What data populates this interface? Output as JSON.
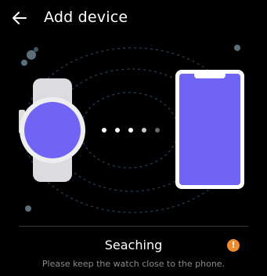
{
  "header": {
    "title": "Add device",
    "back_icon": "arrow-left-icon"
  },
  "scene": {
    "accent_color": "#7064f4",
    "dot_color": "#5a6f7a",
    "ring_color": "#22445a",
    "watch_color": "#e8e8ea",
    "phone_frame_color": "#ffffff",
    "pairing_dots": 5
  },
  "status": {
    "label": "Seaching",
    "info_icon": "info-icon",
    "info_color": "#f08a2e",
    "info_glyph": "!",
    "hint": "Please keep the watch close to the phone."
  }
}
